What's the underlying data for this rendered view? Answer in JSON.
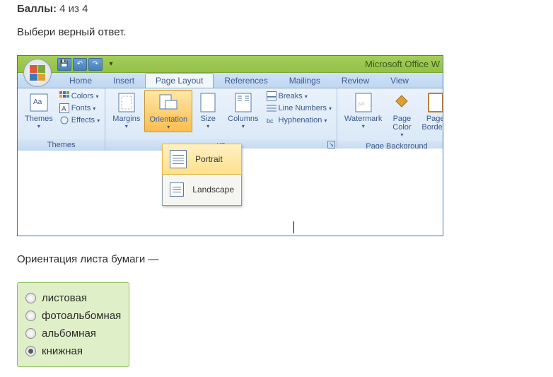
{
  "score": {
    "label": "Баллы:",
    "value": "4 из 4"
  },
  "prompt": "Выбери верный ответ.",
  "app": {
    "title": "Microsoft Office W",
    "qat": {
      "save": "💾",
      "undo": "↶",
      "redo": "↷"
    },
    "tabs": {
      "home": "Home",
      "insert": "Insert",
      "page_layout": "Page Layout",
      "references": "References",
      "mailings": "Mailings",
      "review": "Review",
      "view": "View"
    },
    "groups": {
      "themes": {
        "label": "Themes",
        "themes_btn": "Themes",
        "colors": "Colors",
        "fonts": "Fonts",
        "effects": "Effects"
      },
      "page_setup": {
        "label": "up",
        "margins": "Margins",
        "orientation": "Orientation",
        "size": "Size",
        "columns": "Columns",
        "breaks": "Breaks",
        "line_numbers": "Line Numbers",
        "hyphenation": "Hyphenation"
      },
      "page_background": {
        "label": "Page Background",
        "watermark": "Watermark",
        "page_color": "Page\nColor",
        "page_borders": "Page\nBorders"
      }
    },
    "dropdown": {
      "portrait": "Portrait",
      "landscape": "Landscape"
    }
  },
  "question": "Ориентация листа бумаги —",
  "answers": {
    "a1": "листовая",
    "a2": "фотоальбомная",
    "a3": "альбомная",
    "a4": "книжная"
  }
}
